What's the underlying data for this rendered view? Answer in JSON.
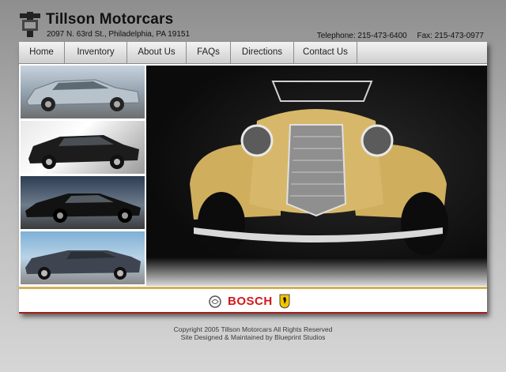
{
  "header": {
    "brand": "Tillson Motorcars",
    "address": "2097 N. 63rd St., Philadelphia, PA 19151",
    "telephone": "Telephone: 215-473-6400",
    "fax": "Fax: 215-473-0977"
  },
  "nav": {
    "items": [
      {
        "label": "Home"
      },
      {
        "label": "Inventory"
      },
      {
        "label": "About Us"
      },
      {
        "label": "FAQs"
      },
      {
        "label": "Directions"
      },
      {
        "label": "Contact Us"
      }
    ]
  },
  "sponsors": {
    "bosch": "BOSCH"
  },
  "footer": {
    "copyright": "Copyright 2005 Tillson Motorcars All Rights Reserved",
    "credits": "Site Designed & Maintained by Blueprint Studios"
  },
  "colors": {
    "nav_border": "#8d8d8d",
    "sponsor_gold": "#cfb25a",
    "sponsor_red": "#a3201e",
    "bosch_red": "#d2181c"
  }
}
